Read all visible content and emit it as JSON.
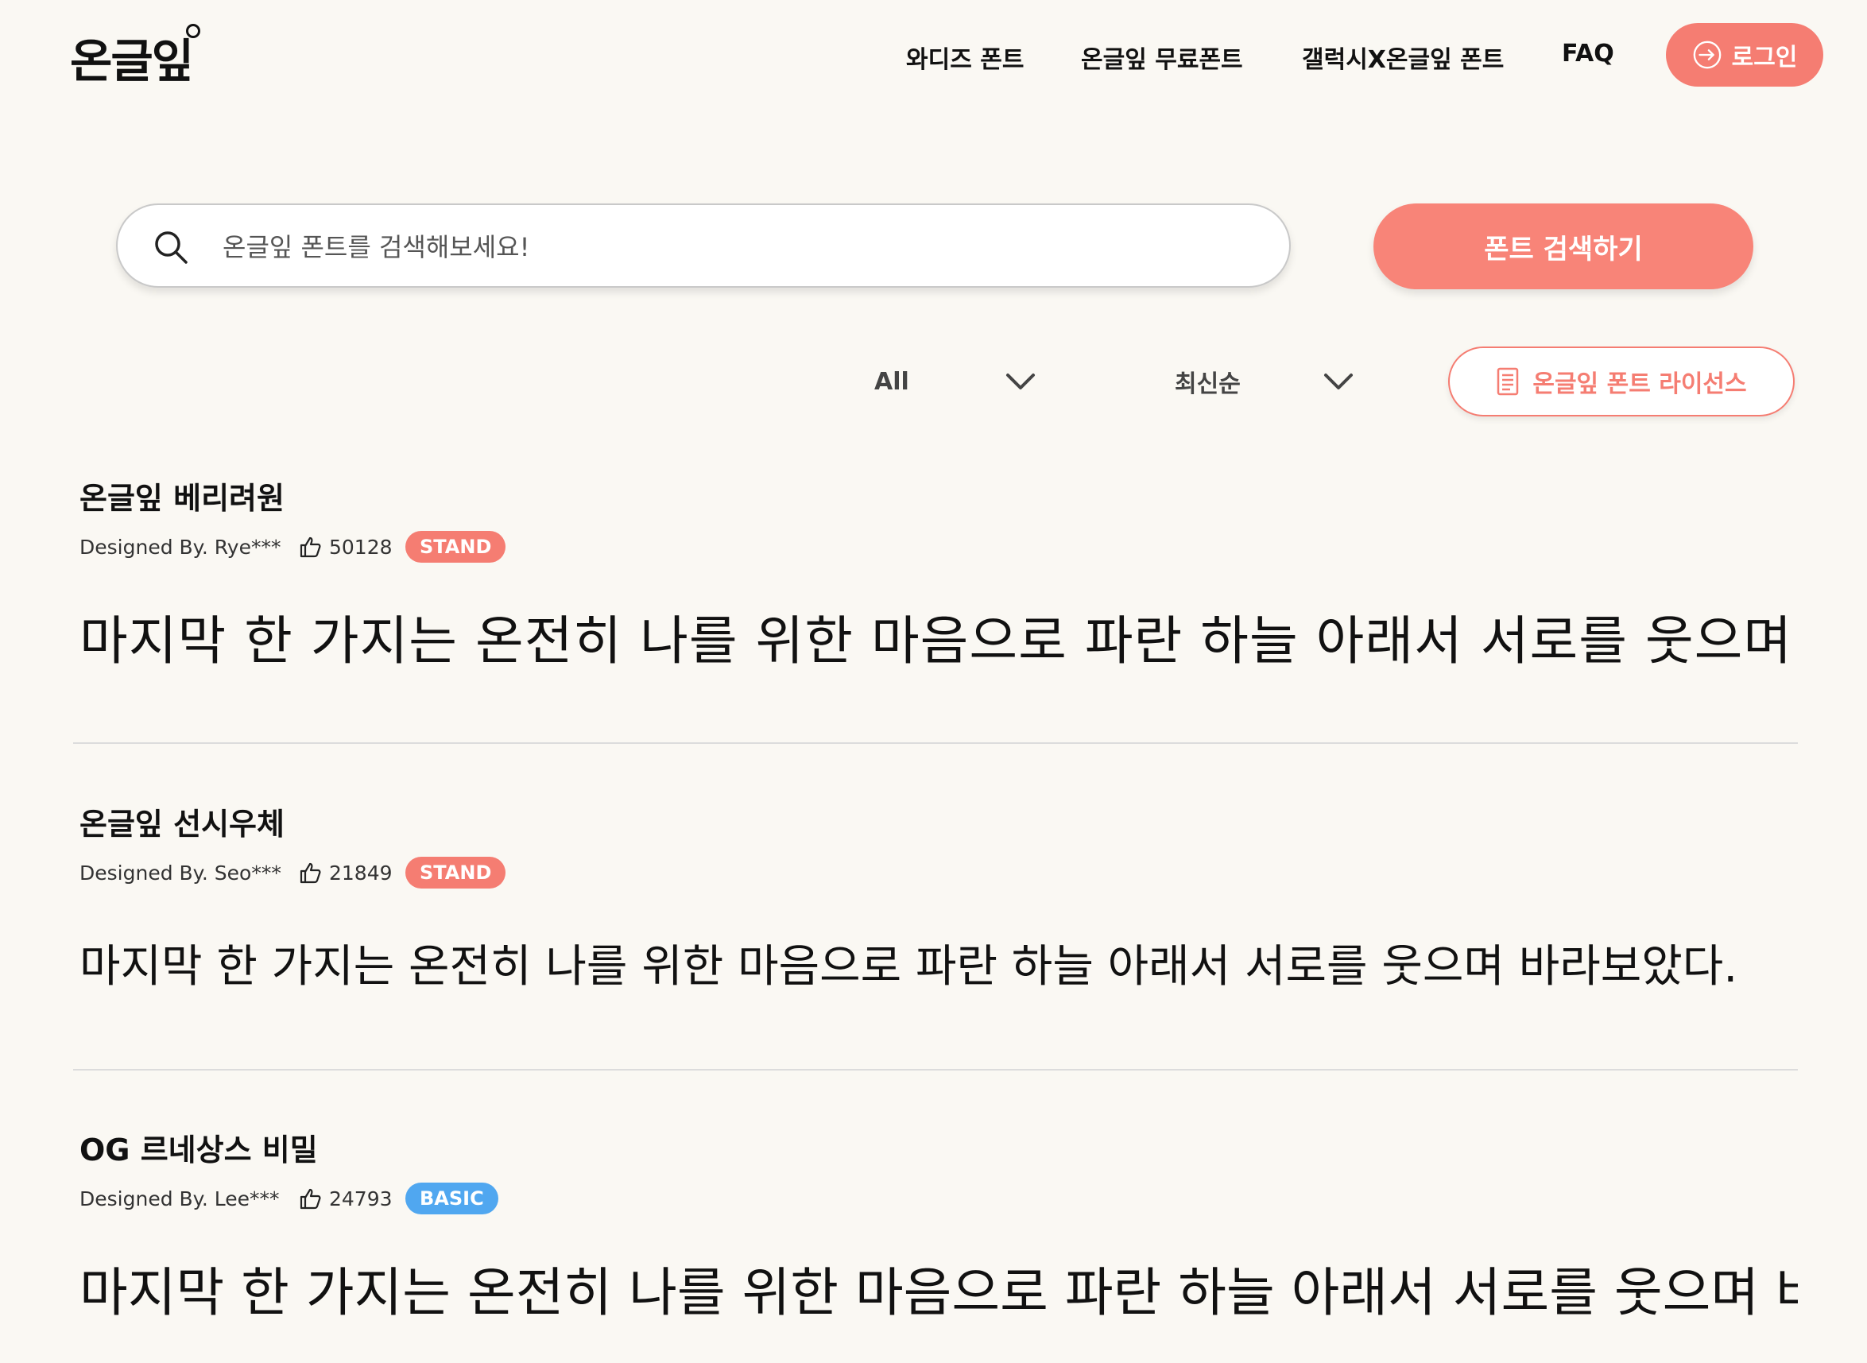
{
  "header": {
    "logo": "온글잎",
    "nav": [
      "와디즈 폰트",
      "온글잎 무료폰트",
      "갤럭시X온글잎 폰트",
      "FAQ"
    ],
    "login_label": "로그인"
  },
  "search": {
    "placeholder": "온글잎 폰트를 검색해보세요!",
    "value": "",
    "button_label": "폰트 검색하기"
  },
  "filters": {
    "category": "All",
    "sort": "최신순",
    "license_label": "온글잎 폰트 라이선스"
  },
  "fonts": [
    {
      "name": "온글잎 베리려원",
      "designer": "Designed By. Rye***",
      "likes": "50128",
      "badge": "STAND",
      "preview": "마지막 한 가지는 온전히 나를 위한 마음으로 파란 하늘 아래서 서로를 웃으며 바라"
    },
    {
      "name": "온글잎 선시우체",
      "designer": "Designed By. Seo***",
      "likes": "21849",
      "badge": "STAND",
      "preview": "마지막 한 가지는 온전히 나를 위한 마음으로 파란 하늘 아래서 서로를 웃으며 바라보았다."
    },
    {
      "name": "OG 르네상스 비밀",
      "designer": "Designed By. Lee***",
      "likes": "24793",
      "badge": "BASIC",
      "preview": "마지막 한 가지는 온전히 나를 위한 마음으로 파란 하늘 아래서 서로를 웃으며 바라"
    }
  ],
  "colors": {
    "accent": "#f57d72",
    "basic_badge": "#50a7f0",
    "background": "#faf8f3"
  },
  "icons": {
    "search": "search-icon",
    "login": "login-arrow-icon",
    "dropdown": "chevron-down-icon",
    "license": "document-icon",
    "like": "thumbs-up-icon"
  }
}
